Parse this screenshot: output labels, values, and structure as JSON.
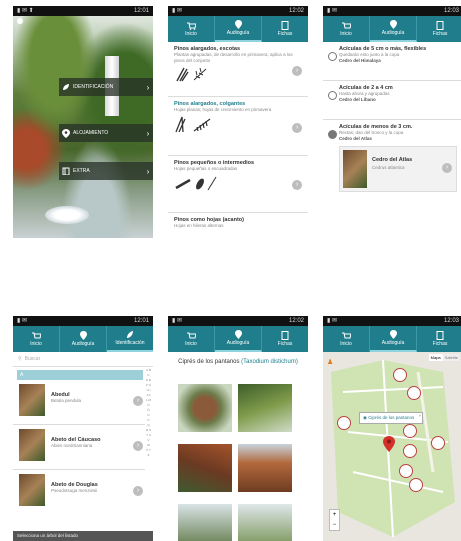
{
  "tabs": {
    "inicio": "Inicio",
    "audioguia": "Audioguía",
    "fichas": "Fichas",
    "identificacion": "Identificación"
  },
  "phone1": {
    "menu": [
      "IDENTIFICACIÓN",
      "ALOJAMIENTO",
      "EXTRA"
    ]
  },
  "phone2": {
    "rows": [
      {
        "title": "Pinos alargados, escotas",
        "sub": "Plantas agrupadas, de desarrollo en primavera; aplica a los pinos del conjunto"
      },
      {
        "title": "Pinos alargados, colgantes",
        "sub": "Hojas planas; hojas de crecimiento en primavera"
      },
      {
        "title": "Pinos pequeños o intermedios",
        "sub": "Hojas pequeñas o escuadradas"
      },
      {
        "title": "Pinos como hojas (acanto)",
        "sub": "Hojas en hileras alternas"
      }
    ]
  },
  "phone3": {
    "options": [
      {
        "title": "Acículas de 5 cm o más, flexibles",
        "sub": "Quedarán esto junto a la copa",
        "extra": "Cedro del Himalaya"
      },
      {
        "title": "Acículas de 2 a 4 cm",
        "sub": "Hasta ahora y agrupadas",
        "extra": "Cedro del Líbano"
      },
      {
        "title": "Acículas de menos de 3 cm.",
        "sub": "Rectas; dan del tronco y la copa",
        "extra": "Cedro del Atlas"
      }
    ],
    "card": {
      "title": "Cedro del Atlas",
      "sub": "Cedrus atlantica"
    }
  },
  "phone4": {
    "search": "Buscar",
    "items": [
      {
        "title": "Abedul",
        "sub": "Betula pendula"
      },
      {
        "title": "Abeto del Cáucaso",
        "sub": "Abies nordmanniana"
      },
      {
        "title": "Abeto de Douglas",
        "sub": "Pseudotsuga menziesii"
      }
    ],
    "footer": "Selecciona un árbol del listado",
    "index": "A B C D E F G H I J K L M N Ñ O P Q R S T U V W X Y Z"
  },
  "phone5": {
    "title": "Ciprés de los pantanos",
    "title_alt": "(Taxodium distichum)"
  },
  "phone6": {
    "callout": "Ciprés de los pantanos",
    "chips": [
      "Mapa",
      "Satélite"
    ]
  },
  "status": {
    "time1": "12:01",
    "time2": "12:02",
    "time3": "12:03"
  }
}
